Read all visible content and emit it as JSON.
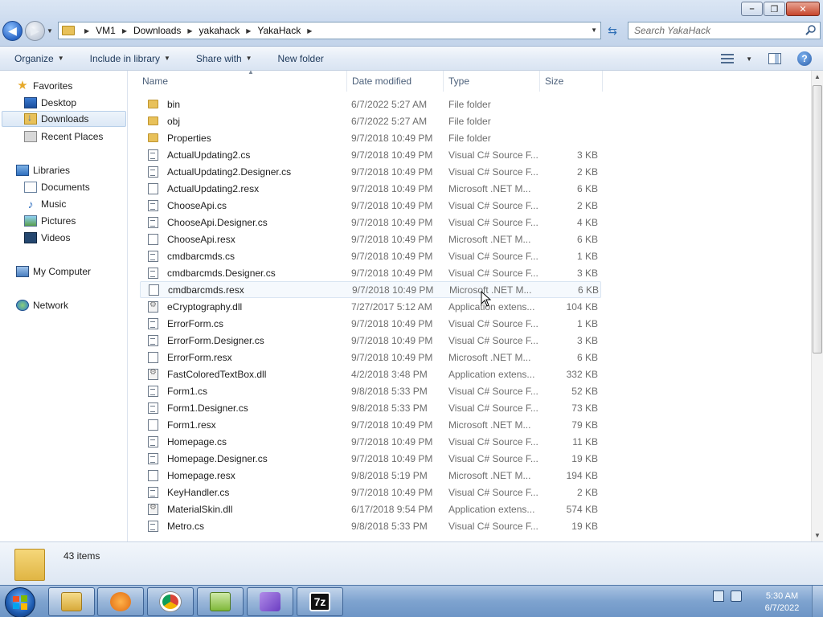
{
  "window": {
    "minimize": "–",
    "maximize": "❐",
    "close": "✕"
  },
  "nav": {
    "back": "◀",
    "forward": "▶"
  },
  "address": {
    "crumbs": [
      "VM1",
      "Downloads",
      "yakahack",
      "YakaHack"
    ]
  },
  "search": {
    "placeholder": "Search YakaHack"
  },
  "toolbar": {
    "organize": "Organize",
    "include_in_library": "Include in library",
    "share_with": "Share with",
    "new_folder": "New folder"
  },
  "sidebar": {
    "favorites": "Favorites",
    "desktop": "Desktop",
    "downloads": "Downloads",
    "recent_places": "Recent Places",
    "libraries": "Libraries",
    "documents": "Documents",
    "music": "Music",
    "pictures": "Pictures",
    "videos": "Videos",
    "my_computer": "My Computer",
    "network": "Network"
  },
  "columns": {
    "name": "Name",
    "date_modified": "Date modified",
    "type": "Type",
    "size": "Size"
  },
  "files": [
    {
      "name": "bin",
      "date": "6/7/2022 5:27 AM",
      "type": "File folder",
      "size": "",
      "kind": "folder"
    },
    {
      "name": "obj",
      "date": "6/7/2022 5:27 AM",
      "type": "File folder",
      "size": "",
      "kind": "folder"
    },
    {
      "name": "Properties",
      "date": "9/7/2018 10:49 PM",
      "type": "File folder",
      "size": "",
      "kind": "folder"
    },
    {
      "name": "ActualUpdating2.cs",
      "date": "9/7/2018 10:49 PM",
      "type": "Visual C# Source F...",
      "size": "3 KB",
      "kind": "cs"
    },
    {
      "name": "ActualUpdating2.Designer.cs",
      "date": "9/7/2018 10:49 PM",
      "type": "Visual C# Source F...",
      "size": "2 KB",
      "kind": "cs"
    },
    {
      "name": "ActualUpdating2.resx",
      "date": "9/7/2018 10:49 PM",
      "type": "Microsoft .NET M...",
      "size": "6 KB",
      "kind": "resx"
    },
    {
      "name": "ChooseApi.cs",
      "date": "9/7/2018 10:49 PM",
      "type": "Visual C# Source F...",
      "size": "2 KB",
      "kind": "cs"
    },
    {
      "name": "ChooseApi.Designer.cs",
      "date": "9/7/2018 10:49 PM",
      "type": "Visual C# Source F...",
      "size": "4 KB",
      "kind": "cs"
    },
    {
      "name": "ChooseApi.resx",
      "date": "9/7/2018 10:49 PM",
      "type": "Microsoft .NET M...",
      "size": "6 KB",
      "kind": "resx"
    },
    {
      "name": "cmdbarcmds.cs",
      "date": "9/7/2018 10:49 PM",
      "type": "Visual C# Source F...",
      "size": "1 KB",
      "kind": "cs"
    },
    {
      "name": "cmdbarcmds.Designer.cs",
      "date": "9/7/2018 10:49 PM",
      "type": "Visual C# Source F...",
      "size": "3 KB",
      "kind": "cs"
    },
    {
      "name": "cmdbarcmds.resx",
      "date": "9/7/2018 10:49 PM",
      "type": "Microsoft .NET M...",
      "size": "6 KB",
      "kind": "resx"
    },
    {
      "name": "eCryptography.dll",
      "date": "7/27/2017 5:12 AM",
      "type": "Application extens...",
      "size": "104 KB",
      "kind": "dll"
    },
    {
      "name": "ErrorForm.cs",
      "date": "9/7/2018 10:49 PM",
      "type": "Visual C# Source F...",
      "size": "1 KB",
      "kind": "cs"
    },
    {
      "name": "ErrorForm.Designer.cs",
      "date": "9/7/2018 10:49 PM",
      "type": "Visual C# Source F...",
      "size": "3 KB",
      "kind": "cs"
    },
    {
      "name": "ErrorForm.resx",
      "date": "9/7/2018 10:49 PM",
      "type": "Microsoft .NET M...",
      "size": "6 KB",
      "kind": "resx"
    },
    {
      "name": "FastColoredTextBox.dll",
      "date": "4/2/2018 3:48 PM",
      "type": "Application extens...",
      "size": "332 KB",
      "kind": "dll"
    },
    {
      "name": "Form1.cs",
      "date": "9/8/2018 5:33 PM",
      "type": "Visual C# Source F...",
      "size": "52 KB",
      "kind": "cs"
    },
    {
      "name": "Form1.Designer.cs",
      "date": "9/8/2018 5:33 PM",
      "type": "Visual C# Source F...",
      "size": "73 KB",
      "kind": "cs"
    },
    {
      "name": "Form1.resx",
      "date": "9/7/2018 10:49 PM",
      "type": "Microsoft .NET M...",
      "size": "79 KB",
      "kind": "resx"
    },
    {
      "name": "Homepage.cs",
      "date": "9/7/2018 10:49 PM",
      "type": "Visual C# Source F...",
      "size": "11 KB",
      "kind": "cs"
    },
    {
      "name": "Homepage.Designer.cs",
      "date": "9/7/2018 10:49 PM",
      "type": "Visual C# Source F...",
      "size": "19 KB",
      "kind": "cs"
    },
    {
      "name": "Homepage.resx",
      "date": "9/8/2018 5:19 PM",
      "type": "Microsoft .NET M...",
      "size": "194 KB",
      "kind": "resx"
    },
    {
      "name": "KeyHandler.cs",
      "date": "9/7/2018 10:49 PM",
      "type": "Visual C# Source F...",
      "size": "2 KB",
      "kind": "cs"
    },
    {
      "name": "MaterialSkin.dll",
      "date": "6/17/2018 9:54 PM",
      "type": "Application extens...",
      "size": "574 KB",
      "kind": "dll"
    },
    {
      "name": "Metro.cs",
      "date": "9/8/2018 5:33 PM",
      "type": "Visual C# Source F...",
      "size": "19 KB",
      "kind": "cs"
    }
  ],
  "status": {
    "item_count": "43 items"
  },
  "taskbar": {
    "time": "5:30 AM",
    "date": "6/7/2022",
    "seven_zip": "7z"
  }
}
